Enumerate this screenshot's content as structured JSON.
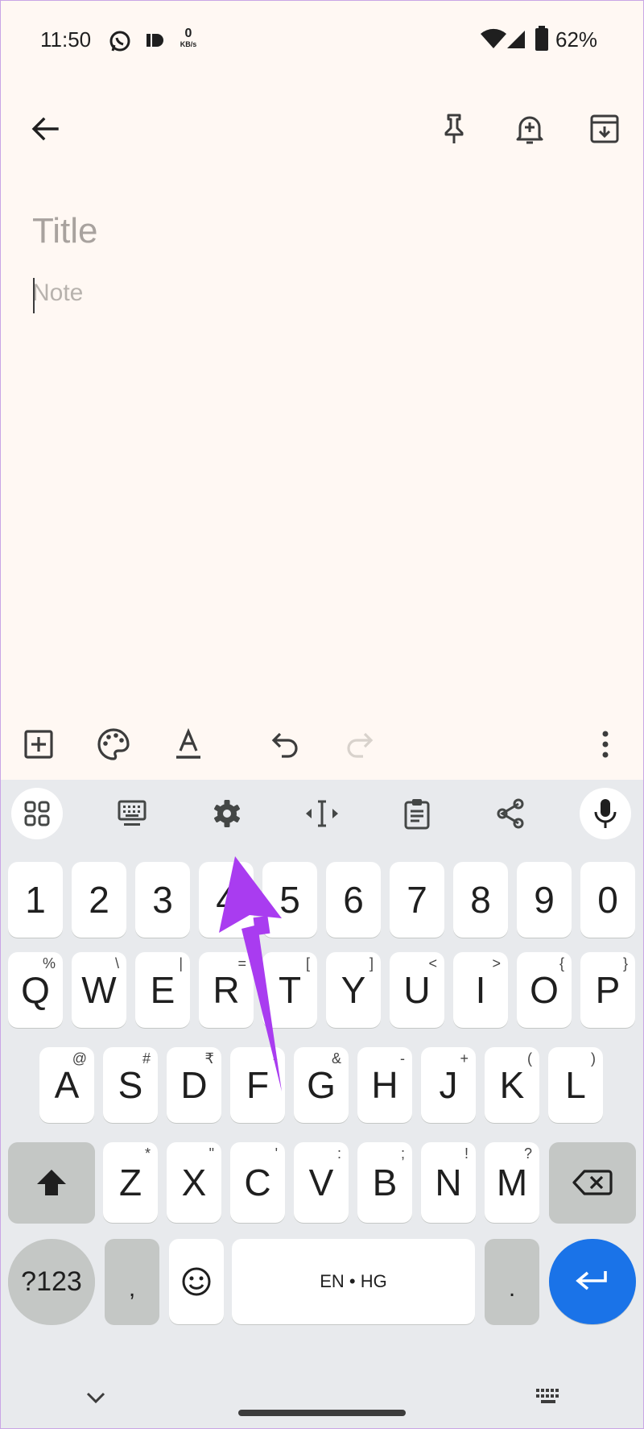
{
  "status_bar": {
    "time": "11:50",
    "net_speed_value": "0",
    "net_speed_unit": "KB/s",
    "battery_percent": "62%",
    "icons": [
      "whatsapp-icon",
      "notification-icon",
      "wifi-icon",
      "cellular-icon",
      "battery-icon"
    ]
  },
  "top_bar": {
    "icons": [
      "back-arrow-icon",
      "pin-icon",
      "reminder-bell-icon",
      "archive-icon"
    ]
  },
  "editor": {
    "title_placeholder": "Title",
    "note_placeholder": "Note"
  },
  "bottom_toolbar": {
    "icons": [
      "add-box-icon",
      "palette-icon",
      "text-format-icon",
      "undo-icon",
      "redo-icon",
      "more-vert-icon"
    ]
  },
  "keyboard_toolbar": {
    "icons": [
      "apps-grid-icon",
      "keyboard-icon",
      "settings-gear-icon",
      "cursor-control-icon",
      "clipboard-icon",
      "share-icon",
      "microphone-icon"
    ]
  },
  "keyboard": {
    "number_row": [
      "1",
      "2",
      "3",
      "4",
      "5",
      "6",
      "7",
      "8",
      "9",
      "0"
    ],
    "row1": [
      {
        "k": "Q",
        "h": "%"
      },
      {
        "k": "W",
        "h": "\\"
      },
      {
        "k": "E",
        "h": "|"
      },
      {
        "k": "R",
        "h": "="
      },
      {
        "k": "T",
        "h": "["
      },
      {
        "k": "Y",
        "h": "]"
      },
      {
        "k": "U",
        "h": "<"
      },
      {
        "k": "I",
        "h": ">"
      },
      {
        "k": "O",
        "h": "{"
      },
      {
        "k": "P",
        "h": "}"
      }
    ],
    "row2": [
      {
        "k": "A",
        "h": "@"
      },
      {
        "k": "S",
        "h": "#"
      },
      {
        "k": "D",
        "h": "₹"
      },
      {
        "k": "F",
        "h": "-"
      },
      {
        "k": "G",
        "h": "&"
      },
      {
        "k": "H",
        "h": "-"
      },
      {
        "k": "J",
        "h": "+"
      },
      {
        "k": "K",
        "h": "("
      },
      {
        "k": "L",
        "h": ")"
      }
    ],
    "row3": [
      {
        "k": "Z",
        "h": "*"
      },
      {
        "k": "X",
        "h": "\""
      },
      {
        "k": "C",
        "h": "'"
      },
      {
        "k": "V",
        "h": ":"
      },
      {
        "k": "B",
        "h": ";"
      },
      {
        "k": "N",
        "h": "!"
      },
      {
        "k": "M",
        "h": "?"
      }
    ],
    "symbols_label": "?123",
    "comma_label": ",",
    "space_label": "EN • HG",
    "period_label": "."
  },
  "colors": {
    "background": "#fff8f3",
    "keyboard_bg": "#e8eaed",
    "enter_key": "#1a73e8",
    "annotation_arrow": "#a93cf0"
  }
}
